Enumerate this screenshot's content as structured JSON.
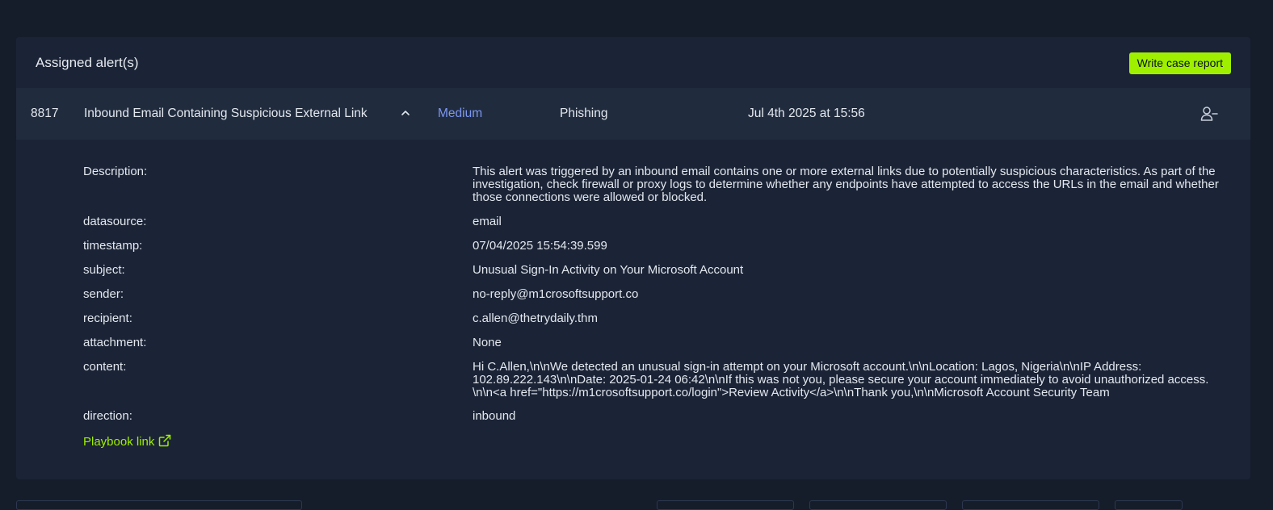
{
  "panel": {
    "title": "Assigned alert(s)",
    "write_report_label": "Write case report"
  },
  "alert": {
    "id": "8817",
    "title": "Inbound Email Containing Suspicious External Link",
    "chevron": "^",
    "severity": "Medium",
    "type": "Phishing",
    "date": "Jul 4th 2025 at 15:56",
    "unassign_icon": "user-minus-icon"
  },
  "details": {
    "description_key": "Description:",
    "description": "This alert was triggered by an inbound email contains one or more external links due to potentially suspicious characteristics. As part of the investigation, check firewall or proxy logs to determine whether any endpoints have attempted to access the URLs in the email and whether those connections were allowed or blocked.",
    "datasource_key": "datasource:",
    "datasource": "email",
    "timestamp_key": "timestamp:",
    "timestamp": "07/04/2025 15:54:39.599",
    "subject_key": "subject:",
    "subject": "Unusual Sign-In Activity on Your Microsoft Account",
    "sender_key": "sender:",
    "sender": "no-reply@m1crosoftsupport.co",
    "recipient_key": "recipient:",
    "recipient": "c.allen@thetrydaily.thm",
    "attachment_key": "attachment:",
    "attachment": "None",
    "content_key": "content:",
    "content": "Hi C.Allen,\\n\\nWe detected an unusual sign-in attempt on your Microsoft account.\\n\\nLocation: Lagos, Nigeria\\n\\nIP Address: 102.89.222.143\\n\\nDate: 2025-01-24 06:42\\n\\nIf this was not you, please secure your account immediately to avoid unauthorized access. \\n\\n<a href=\"https://m1crosoftsupport.co/login\">Review Activity</a>\\n\\nThank you,\\n\\nMicrosoft Account Security Team",
    "direction_key": "direction:",
    "direction": "inbound",
    "playbook_label": "Playbook link",
    "playbook_icon": "external-link-icon"
  },
  "colors": {
    "background": "#151d2b",
    "panel": "#1b2436",
    "row": "#202b3d",
    "accent": "#9fef00",
    "severity_medium": "#7d96f0"
  }
}
